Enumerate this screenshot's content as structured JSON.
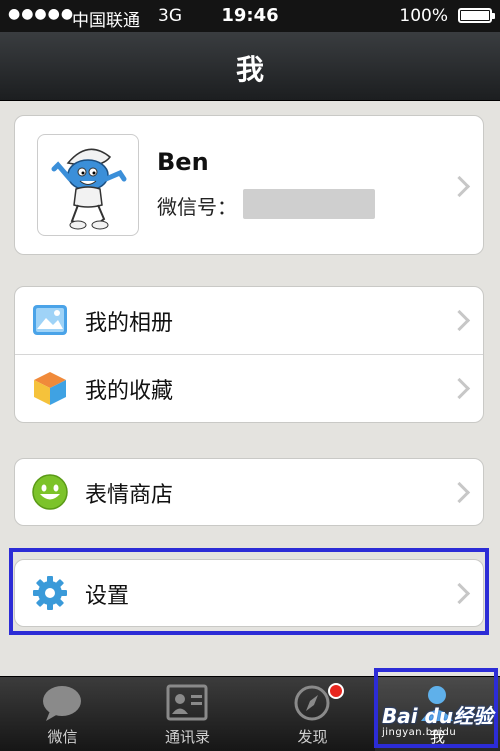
{
  "status_bar": {
    "signal": "●●●●●",
    "carrier": "中国联通",
    "network": "3G",
    "time": "19:46",
    "battery": "100%"
  },
  "nav": {
    "title": "我"
  },
  "profile": {
    "name": "Ben",
    "wechat_id_label": "微信号："
  },
  "menu": {
    "album": "我的相册",
    "favorites": "我的收藏",
    "sticker_store": "表情商店",
    "settings": "设置"
  },
  "tabs": [
    {
      "label": "微信",
      "icon": "chat-bubble-icon"
    },
    {
      "label": "通讯录",
      "icon": "contacts-icon"
    },
    {
      "label": "发现",
      "icon": "compass-icon"
    },
    {
      "label": "我",
      "icon": "person-icon"
    }
  ],
  "watermark": {
    "top": "Bai du经验",
    "bottom": "jingyan.baidu"
  },
  "colors": {
    "highlight": "#2c2cd6",
    "badge": "#e8261f",
    "accent_green": "#7cc32a"
  }
}
